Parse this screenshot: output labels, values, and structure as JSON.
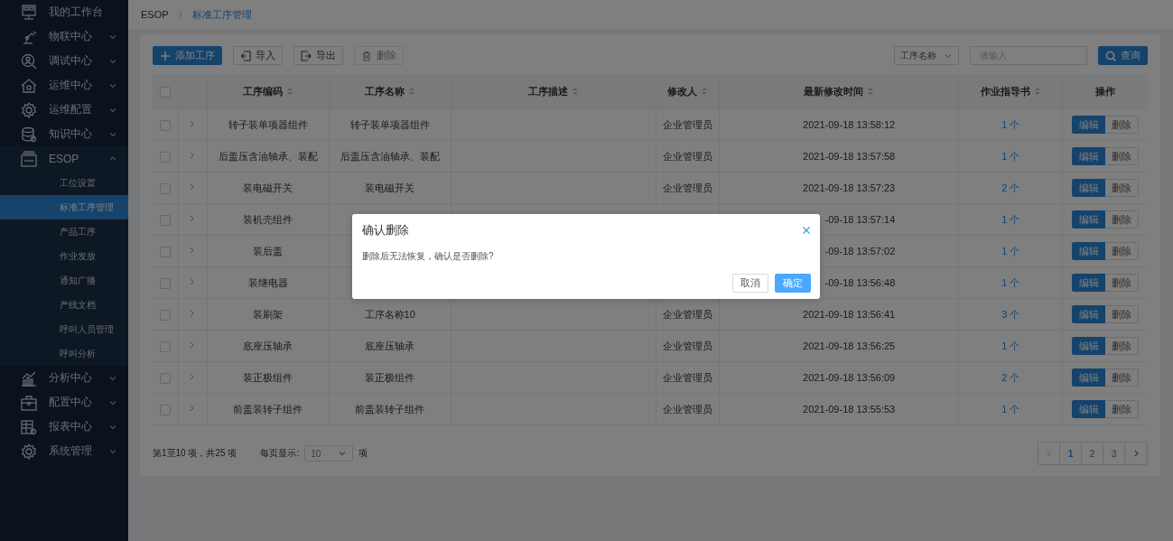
{
  "sidebar": {
    "items": [
      {
        "label": "我的工作台"
      },
      {
        "label": "物联中心",
        "expanded": false
      },
      {
        "label": "调试中心",
        "expanded": false
      },
      {
        "label": "运维中心",
        "expanded": false
      },
      {
        "label": "运维配置",
        "expanded": false
      },
      {
        "label": "知识中心",
        "expanded": false
      },
      {
        "label": "ESOP",
        "expanded": true,
        "children": [
          {
            "label": "工位设置",
            "selected": false
          },
          {
            "label": "标准工序管理",
            "selected": true
          },
          {
            "label": "产品工序",
            "selected": false
          },
          {
            "label": "作业发放",
            "selected": false
          },
          {
            "label": "通知广播",
            "selected": false
          },
          {
            "label": "产线文档",
            "selected": false
          },
          {
            "label": "呼叫人员管理",
            "selected": false
          },
          {
            "label": "呼叫分析",
            "selected": false
          }
        ]
      },
      {
        "label": "分析中心",
        "expanded": false
      },
      {
        "label": "配置中心",
        "expanded": false
      },
      {
        "label": "报表中心",
        "expanded": false
      },
      {
        "label": "系统管理",
        "expanded": false
      }
    ]
  },
  "breadcrumb": [
    {
      "label": "ESOP",
      "current": false
    },
    {
      "label": "标准工序管理",
      "current": true
    }
  ],
  "toolbar": {
    "buttons": [
      {
        "label": "添加工序",
        "kind": "primary",
        "disabled": false
      },
      {
        "label": "导入",
        "kind": "default",
        "disabled": false
      },
      {
        "label": "导出",
        "kind": "default",
        "disabled": false
      },
      {
        "label": "删除",
        "kind": "default",
        "disabled": true
      }
    ],
    "search_field_select": "工序名称",
    "search_input": {
      "placeholder": "请输入"
    },
    "search_button": "查询"
  },
  "table": {
    "header_checked": false,
    "columns": [
      {
        "label": "工序编码",
        "sortable": true
      },
      {
        "label": "工序名称",
        "sortable": true
      },
      {
        "label": "工序描述",
        "sortable": true
      },
      {
        "label": "修改人",
        "sortable": true
      },
      {
        "label": "最新修改时间",
        "sortable": true
      },
      {
        "label": "作业指导书",
        "sortable": true
      },
      {
        "label": "操作",
        "sortable": false
      }
    ],
    "rows": [
      {
        "checked": false,
        "code": "转子装单项器组件",
        "name": "转子装单项器组件",
        "modifier": "企业管理员",
        "modified": "2021-09-18 13:58:12",
        "docs": "1 个",
        "actions": [
          "编辑",
          "删除"
        ]
      },
      {
        "checked": false,
        "code": "后盖压含油轴承、装配",
        "name": "后盖压含油轴承、装配",
        "modifier": "企业管理员",
        "modified": "2021-09-18 13:57:58",
        "docs": "1 个",
        "actions": [
          "编辑",
          "删除"
        ]
      },
      {
        "checked": false,
        "code": "装电磁开关",
        "name": "装电磁开关",
        "modifier": "企业管理员",
        "modified": "2021-09-18 13:57:23",
        "docs": "2 个",
        "actions": [
          "编辑",
          "删除"
        ]
      },
      {
        "checked": false,
        "code": "装机壳组件",
        "modified": "-09-18 13:57:14",
        "docs": "1 个",
        "actions": [
          "编辑",
          "删除"
        ]
      },
      {
        "checked": false,
        "code": "装后盖",
        "modified": "-09-18 13:57:02",
        "docs": "1 个",
        "actions": [
          "编辑",
          "删除"
        ]
      },
      {
        "checked": false,
        "code": "装继电器",
        "modified": "-09-18 13:56:48",
        "docs": "1 个",
        "actions": [
          "编辑",
          "删除"
        ]
      },
      {
        "checked": false,
        "code": "装刷架",
        "name": "工序名称10",
        "modifier": "企业管理员",
        "modified": "2021-09-18 13:56:41",
        "docs": "3 个",
        "actions": [
          "编辑",
          "删除"
        ]
      },
      {
        "checked": false,
        "code": "底座压轴承",
        "name": "底座压轴承",
        "modifier": "企业管理员",
        "modified": "2021-09-18 13:56:25",
        "docs": "1 个",
        "actions": [
          "编辑",
          "删除"
        ]
      },
      {
        "checked": false,
        "code": "装正极组件",
        "name": "装正极组件",
        "modifier": "企业管理员",
        "modified": "2021-09-18 13:56:09",
        "docs": "2 个",
        "actions": [
          "编辑",
          "删除"
        ]
      },
      {
        "checked": false,
        "code": "前盖装转子组件",
        "name": "前盖装转子组件",
        "modifier": "企业管理员",
        "modified": "2021-09-18 13:55:53",
        "docs": "1 个",
        "actions": [
          "编辑",
          "删除"
        ]
      }
    ]
  },
  "footer": {
    "summary": "第1至10 项，共25 项",
    "page_size_label": "每页显示:",
    "page_size": "10",
    "page_size_unit": "项",
    "pages": [
      {
        "label": "1",
        "selected": true
      },
      {
        "label": "2",
        "selected": false
      },
      {
        "label": "3",
        "selected": false
      }
    ],
    "prev_disabled": true,
    "next_disabled": false
  },
  "dialog": {
    "title": "确认删除",
    "message": "删除后无法恢复，确认是否删除?",
    "buttons": [
      {
        "label": "取消",
        "kind": "default"
      },
      {
        "label": "确定",
        "kind": "primary"
      }
    ]
  }
}
